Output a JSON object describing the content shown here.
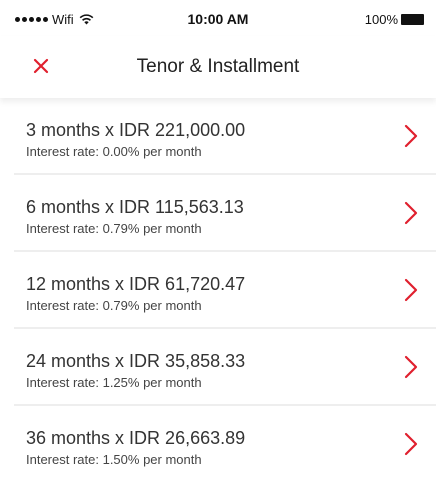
{
  "status_bar": {
    "carrier": "Wifi",
    "time": "10:00 AM",
    "battery": "100%"
  },
  "nav": {
    "title": "Tenor & Installment",
    "close_icon": "close-icon"
  },
  "colors": {
    "accent": "#e0202e",
    "divider": "#eeeeee"
  },
  "options": [
    {
      "title": "3 months x IDR 221,000.00",
      "subtitle": "Interest rate: 0.00% per month"
    },
    {
      "title": "6 months x IDR 115,563.13",
      "subtitle": "Interest rate: 0.79% per month"
    },
    {
      "title": "12 months x IDR 61,720.47",
      "subtitle": "Interest rate: 0.79% per month"
    },
    {
      "title": "24 months x IDR 35,858.33",
      "subtitle": "Interest rate: 1.25% per month"
    },
    {
      "title": "36 months x IDR 26,663.89",
      "subtitle": "Interest rate: 1.50% per month"
    }
  ]
}
